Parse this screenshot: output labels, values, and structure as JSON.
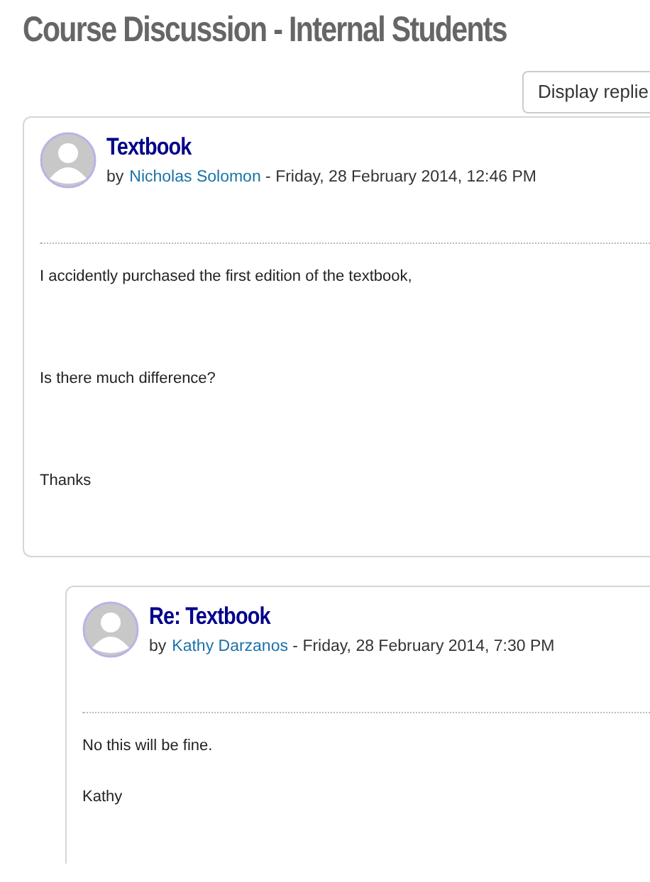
{
  "page_title": "Course Discussion - Internal Students",
  "display_button": {
    "label": "Display replie"
  },
  "posts": [
    {
      "subject": "Textbook",
      "by": "by",
      "author": "Nicholas Solomon",
      "date": " - Friday, 28 February 2014, 12:46 PM",
      "paragraphs": [
        "I accidently purchased the first edition of the textbook,",
        "Is there much difference?",
        "Thanks"
      ],
      "children": [
        {
          "subject": "Re: Textbook",
          "by": "by",
          "author": "Kathy Darzanos",
          "date": " - Friday, 28 February 2014, 7:30 PM",
          "paragraphs": [
            "No this will be fine.",
            "Kathy"
          ]
        }
      ]
    }
  ]
}
